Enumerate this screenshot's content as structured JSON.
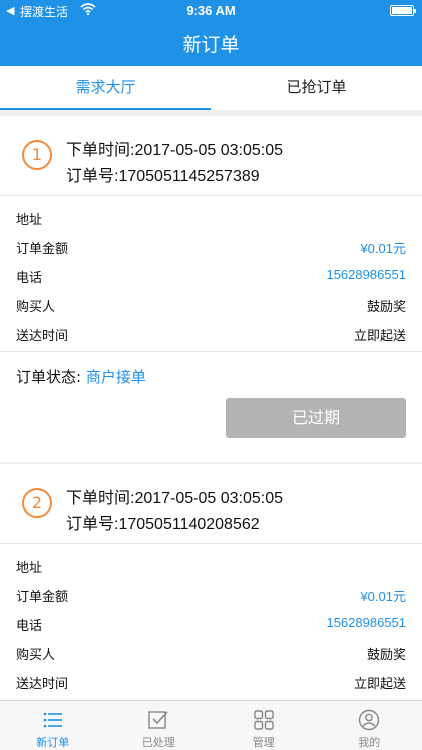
{
  "status_bar": {
    "back_arrow": "◀",
    "carrier": "摆渡生活",
    "time": "9:36 AM"
  },
  "nav": {
    "title": "新订单"
  },
  "tabs": [
    {
      "label": "需求大厅",
      "active": true
    },
    {
      "label": "已抢订单",
      "active": false
    }
  ],
  "orders": [
    {
      "index": "1",
      "order_time": "下单时间:2017-05-05 03:05:05",
      "order_no": "订单号:1705051145257389",
      "rows": [
        {
          "key": "地址",
          "value": ""
        },
        {
          "key": "订单金额",
          "value": "¥0.01元"
        },
        {
          "key": "电话",
          "value": "15628986551"
        },
        {
          "key": "购买人",
          "value": "鼓励奖"
        },
        {
          "key": "送达时间",
          "value": "立即起送"
        }
      ],
      "status_label": "订单状态:",
      "status_value": "商户接单",
      "button": "已过期"
    },
    {
      "index": "2",
      "order_time": "下单时间:2017-05-05 03:05:05",
      "order_no": "订单号:1705051140208562",
      "rows": [
        {
          "key": "地址",
          "value": ""
        },
        {
          "key": "订单金额",
          "value": "¥0.01元"
        },
        {
          "key": "电话",
          "value": "15628986551"
        },
        {
          "key": "购买人",
          "value": "鼓励奖"
        },
        {
          "key": "送达时间",
          "value": "立即起送"
        }
      ]
    }
  ],
  "tabbar": [
    {
      "label": "新订单",
      "icon": "list-icon",
      "active": true
    },
    {
      "label": "已处理",
      "icon": "checkbox-icon",
      "active": false
    },
    {
      "label": "管理",
      "icon": "grid-icon",
      "active": false
    },
    {
      "label": "我的",
      "icon": "user-icon",
      "active": false
    }
  ],
  "colors": {
    "brand_blue": "#1f92e8",
    "badge_orange": "#f08a3c",
    "disabled_button": "#b4b4b4"
  }
}
